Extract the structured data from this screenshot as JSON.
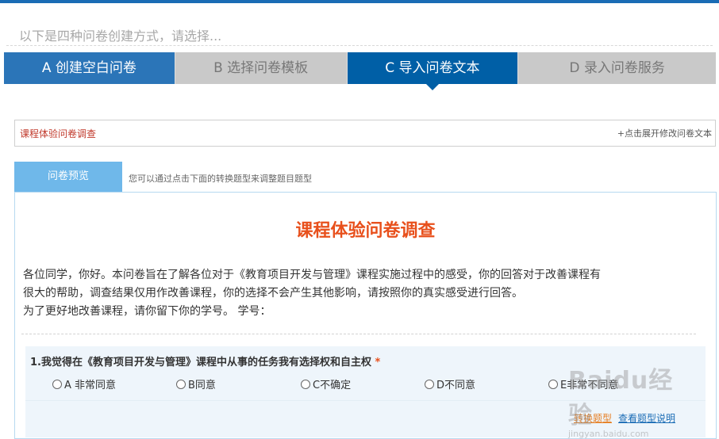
{
  "intro": {
    "text": "以下是四种问卷创建方式，请选择..."
  },
  "tabs": [
    {
      "label": "A 创建空白问卷",
      "active": false
    },
    {
      "label": "B 选择问卷模板",
      "active": false
    },
    {
      "label": "C 导入问卷文本",
      "active": true
    },
    {
      "label": "D 录入问卷服务",
      "active": false
    }
  ],
  "title_box": {
    "name": "课程体验问卷调查",
    "expand_label": "+点击展开修改问卷文本"
  },
  "preview": {
    "tab_label": "问卷预览",
    "hint": "您可以通过点击下面的转换题型来调整题目题型"
  },
  "survey": {
    "title": "课程体验问卷调查",
    "desc_lines": [
      "各位同学，你好。本问卷旨在了解各位对于《教育项目开发与管理》课程实施过程中的感受，你的回答对于改善课程有",
      "很大的帮助，调查结果仅用作改善课程，你的选择不会产生其他影响，请按照你的真实感受进行回答。",
      "为了更好地改善课程，请你留下你的学号。 学号："
    ],
    "question": {
      "title": "1.我觉得在《教育项目开发与管理》课程中从事的任务我有选择权和自主权",
      "required_mark": "*",
      "options": [
        "A 非常同意",
        "B同意",
        "C不确定",
        "D不同意",
        "E非常不同意"
      ],
      "convert_link": "转换题型",
      "explain_link": "查看题型说明"
    }
  },
  "watermark": {
    "logo": "Baidu经验",
    "url": "jingyan.baidu.com"
  },
  "colors": {
    "accent": "#005fa6",
    "title_red": "#e8501c",
    "preview_blue": "#6fb8ea"
  }
}
